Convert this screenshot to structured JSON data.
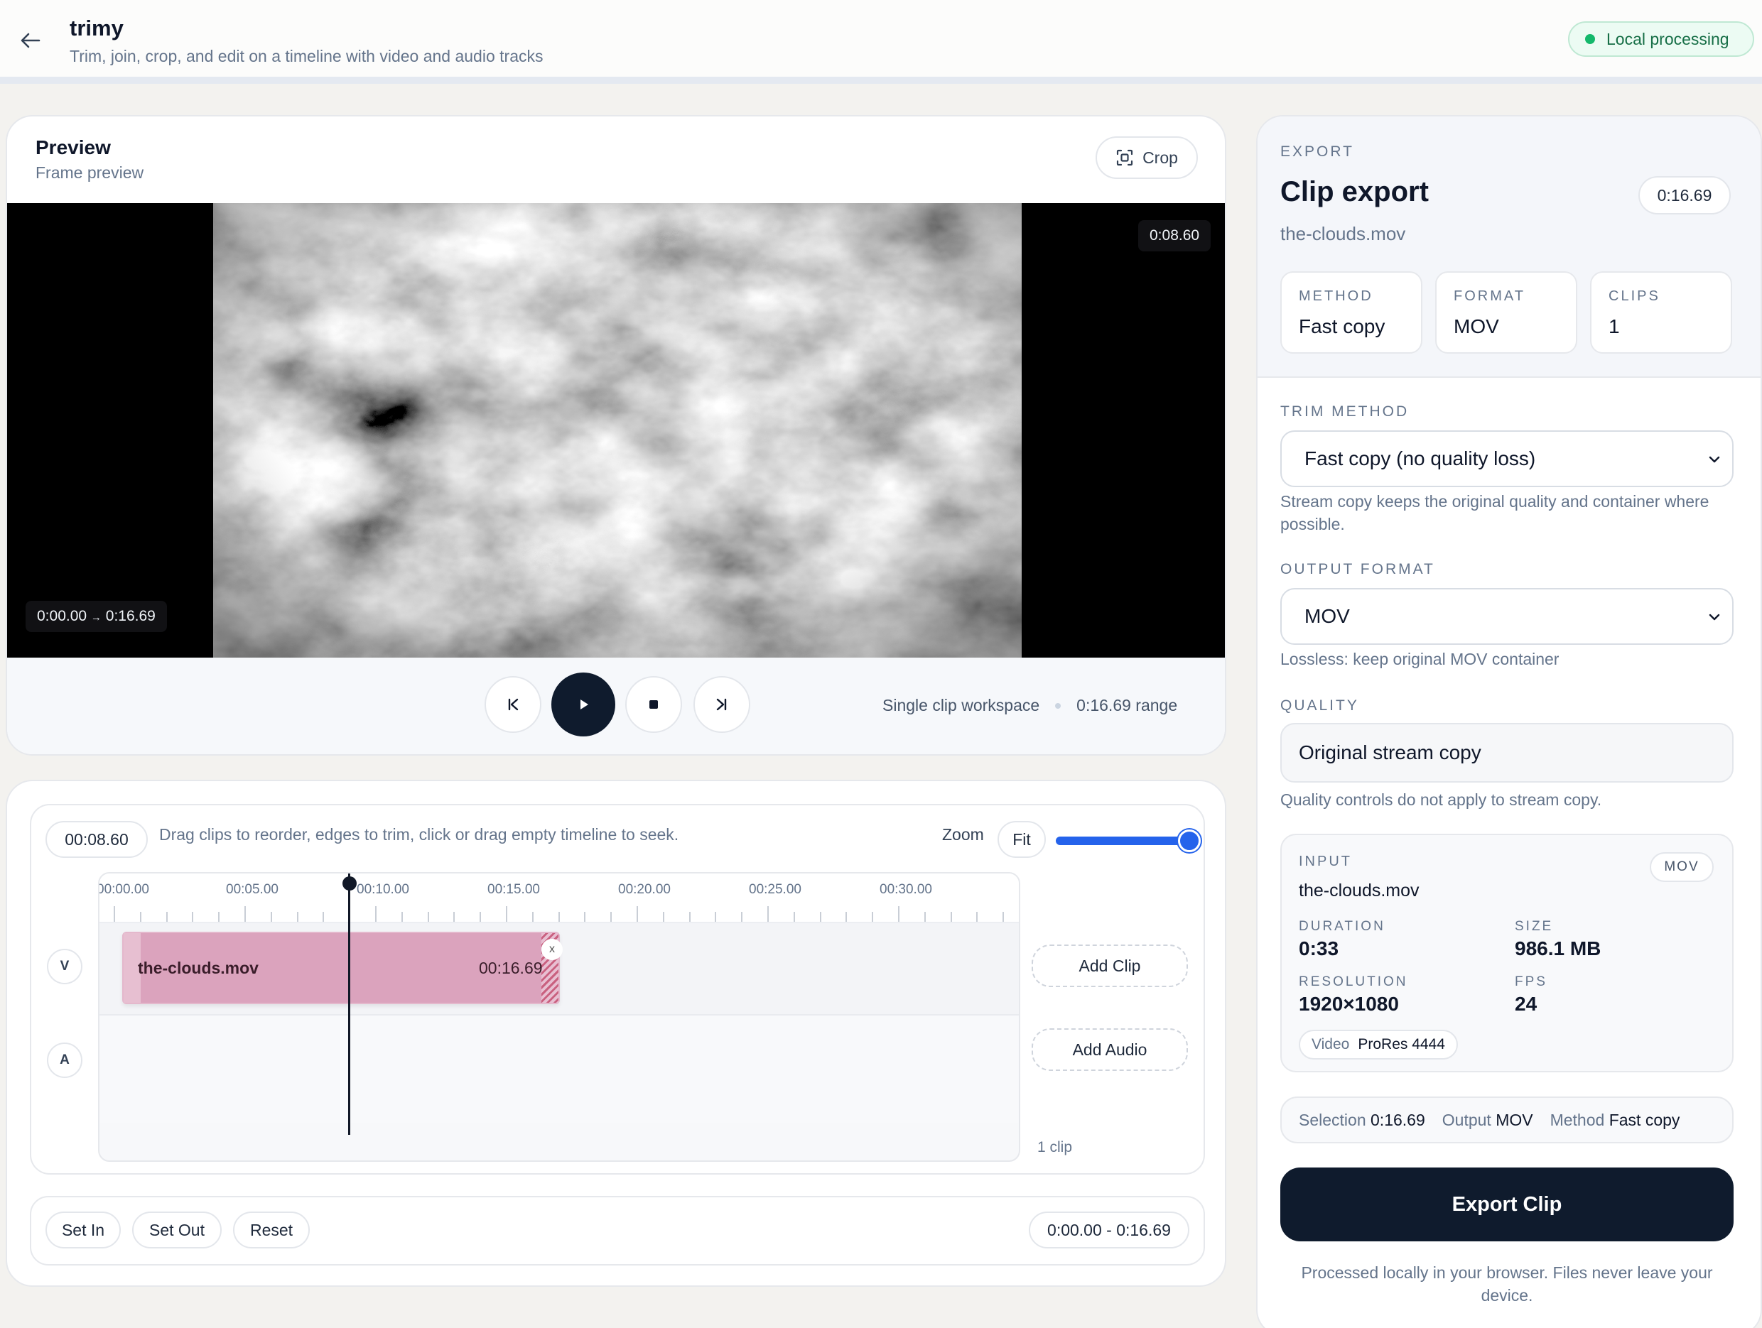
{
  "header": {
    "title": "trimy",
    "subtitle": "Trim, join, crop, and edit on a timeline with video and audio tracks",
    "badge": "Local processing"
  },
  "preview": {
    "title": "Preview",
    "subtitle": "Frame preview",
    "crop_label": "Crop",
    "current_time": "0:08.60",
    "range_tag_start": "0:00.00",
    "range_tag_arrow": "→",
    "range_tag_end": "0:16.69",
    "workspace_label": "Single clip workspace",
    "range_label": "0:16.69 range"
  },
  "timeline": {
    "time": "00:08.60",
    "hint": "Drag clips to reorder, edges to trim, click or drag empty timeline to seek.",
    "zoom_label": "Zoom",
    "fit_label": "Fit",
    "zoom_level": 1.0,
    "ruler_labels": [
      "00:00.00",
      "00:05.00",
      "00:10.00",
      "00:15.00",
      "00:20.00",
      "00:25.00",
      "00:30.00"
    ],
    "video_track_tag": "V",
    "audio_track_tag": "A",
    "clip_name": "the-clouds.mov",
    "clip_duration": "00:16.69",
    "clip_close": "x",
    "add_clip": "Add Clip",
    "add_audio": "Add Audio",
    "clip_count": "1 clip",
    "set_in": "Set In",
    "set_out": "Set Out",
    "reset": "Reset",
    "selection_range": "0:00.00 - 0:16.69"
  },
  "export": {
    "eyebrow": "EXPORT",
    "title": "Clip export",
    "filename": "the-clouds.mov",
    "duration": "0:16.69",
    "stats": [
      {
        "label": "METHOD",
        "value": "Fast copy"
      },
      {
        "label": "FORMAT",
        "value": "MOV"
      },
      {
        "label": "CLIPS",
        "value": "1"
      }
    ],
    "trim_method_label": "TRIM METHOD",
    "trim_method_value": "Fast copy (no quality loss)",
    "trim_method_help": "Stream copy keeps the original quality and container where possible.",
    "output_format_label": "OUTPUT FORMAT",
    "output_format_value": "MOV",
    "output_format_help": "Lossless: keep original MOV container",
    "quality_label": "QUALITY",
    "quality_value": "Original stream copy",
    "quality_help": "Quality controls do not apply to stream copy.",
    "input": {
      "label": "INPUT",
      "chip": "MOV",
      "filename": "the-clouds.mov",
      "duration_label": "DURATION",
      "duration": "0:33",
      "size_label": "SIZE",
      "size": "986.1 MB",
      "resolution_label": "RESOLUTION",
      "resolution": "1920×1080",
      "fps_label": "FPS",
      "fps": "24",
      "codec_key": "Video",
      "codec": "ProRes 4444"
    },
    "summary": {
      "selection_key": "Selection",
      "selection": "0:16.69",
      "output_key": "Output",
      "output": "MOV",
      "method_key": "Method",
      "method": "Fast copy"
    },
    "button": "Export Clip",
    "footer": "Processed locally in your browser. Files never leave your device."
  },
  "colors": {
    "accent": "#2563eb",
    "dark": "#0f1b2d",
    "clip": "#dba3bd",
    "success": "#14b86b"
  }
}
